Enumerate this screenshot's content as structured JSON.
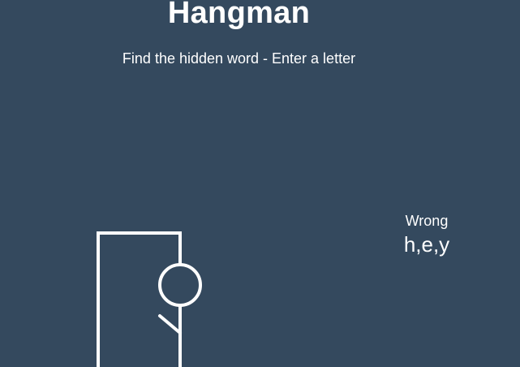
{
  "header": {
    "title": "Hangman",
    "subtitle": "Find the hidden word - Enter a letter"
  },
  "wrong": {
    "label": "Wrong",
    "letters": "h,e,y",
    "count": 3
  },
  "colors": {
    "background": "#34495e",
    "foreground": "#ffffff"
  }
}
